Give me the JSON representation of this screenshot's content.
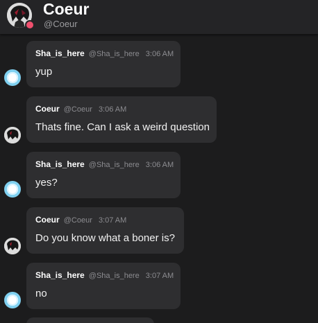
{
  "header": {
    "name": "Coeur",
    "handle": "@Coeur"
  },
  "messages": [
    {
      "author": "Sha_is_here",
      "handle": "@Sha_is_here",
      "time": "3:06 AM",
      "text": "yup",
      "avatar_icon": "bubble-avatar-icon"
    },
    {
      "author": "Coeur",
      "handle": "@Coeur",
      "time": "3:06 AM",
      "text": "Thats fine. Can I ask a weird question",
      "avatar_icon": "anime-character-avatar-icon"
    },
    {
      "author": "Sha_is_here",
      "handle": "@Sha_is_here",
      "time": "3:06 AM",
      "text": "yes?",
      "avatar_icon": "bubble-avatar-icon"
    },
    {
      "author": "Coeur",
      "handle": "@Coeur",
      "time": "3:07 AM",
      "text": "Do you know what a boner is?",
      "avatar_icon": "anime-character-avatar-icon"
    },
    {
      "author": "Sha_is_here",
      "handle": "@Sha_is_here",
      "time": "3:07 AM",
      "text": "no",
      "avatar_icon": "bubble-avatar-icon"
    }
  ],
  "colors": {
    "background": "#1c1c1d",
    "header": "#242426",
    "bubble": "#2e2e30",
    "status": "#f0506e"
  }
}
